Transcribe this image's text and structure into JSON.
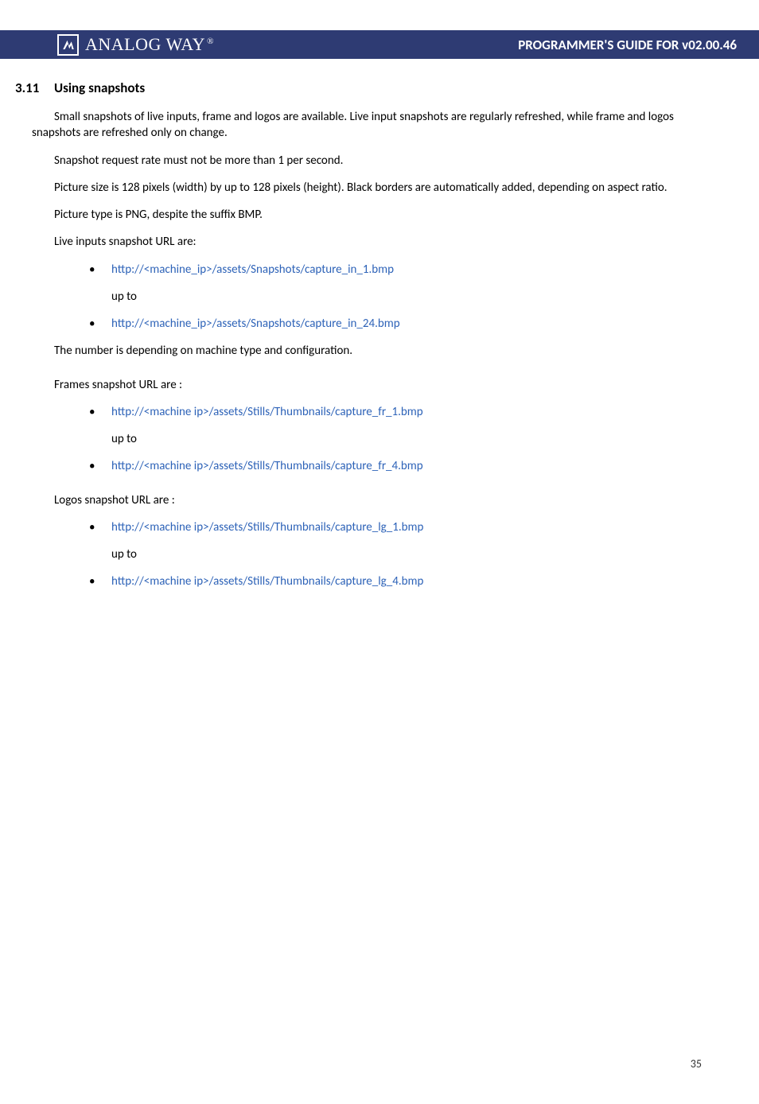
{
  "header": {
    "brand": "ANALOG WAY",
    "reg": "®",
    "title": "PROGRAMMER'S GUIDE FOR v02.00.46"
  },
  "section": {
    "number": "3.11",
    "title": "Using snapshots"
  },
  "paras": {
    "p1": "Small snapshots of live inputs, frame and logos are available. Live input snapshots are regularly refreshed, while frame and logos snapshots are refreshed only on change.",
    "p2": "Snapshot request rate must not be more than 1 per second.",
    "p3": "Picture size is 128 pixels (width) by up to 128 pixels (height). Black borders are automatically added, depending on aspect ratio.",
    "p4": "Picture type is PNG, despite the suffix BMP.",
    "p5": "Live inputs snapshot URL are:",
    "p6": "The number is depending on machine type and configuration.",
    "p7": "Frames snapshot URL are :",
    "p8": "Logos snapshot URL are :"
  },
  "lists": {
    "live": {
      "first": "http://<machine_ip>/assets/Snapshots/capture_in_1.bmp",
      "upto": "up to",
      "last": "http://<machine_ip>/assets/Snapshots/capture_in_24.bmp"
    },
    "frames": {
      "first": "http://<machine ip>/assets/Stills/Thumbnails/capture_fr_1.bmp",
      "upto": "up to",
      "last": "http://<machine ip>/assets/Stills/Thumbnails/capture_fr_4.bmp"
    },
    "logos": {
      "first": "http://<machine ip>/assets/Stills/Thumbnails/capture_lg_1.bmp",
      "upto": "up to",
      "last": "http://<machine ip>/assets/Stills/Thumbnails/capture_lg_4.bmp"
    }
  },
  "page_num": "35"
}
